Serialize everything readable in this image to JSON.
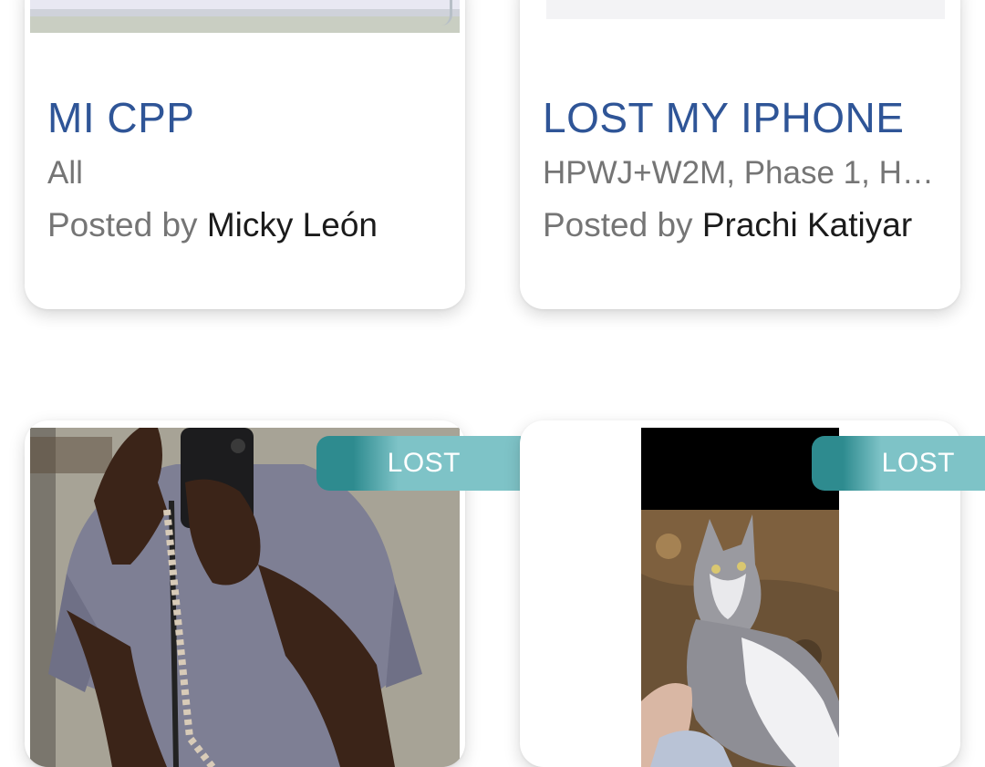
{
  "cards": [
    {
      "title": "MI CPP",
      "location": "All",
      "posted_prefix": "Posted by",
      "author": "Micky León"
    },
    {
      "title": "LOST MY IPHONE",
      "location": "HPWJ+W2M, Phase 1, Hi...",
      "posted_prefix": "Posted by",
      "author": "Prachi Katiyar"
    },
    {
      "status": "LOST",
      "image": "person-mirror-selfie-photo"
    },
    {
      "status": "LOST",
      "image": "cat-photo"
    }
  ],
  "colors": {
    "title": "#2f5597",
    "muted_text": "#757575",
    "author_text": "#1b1b1b",
    "badge": "#4fa7ab"
  }
}
